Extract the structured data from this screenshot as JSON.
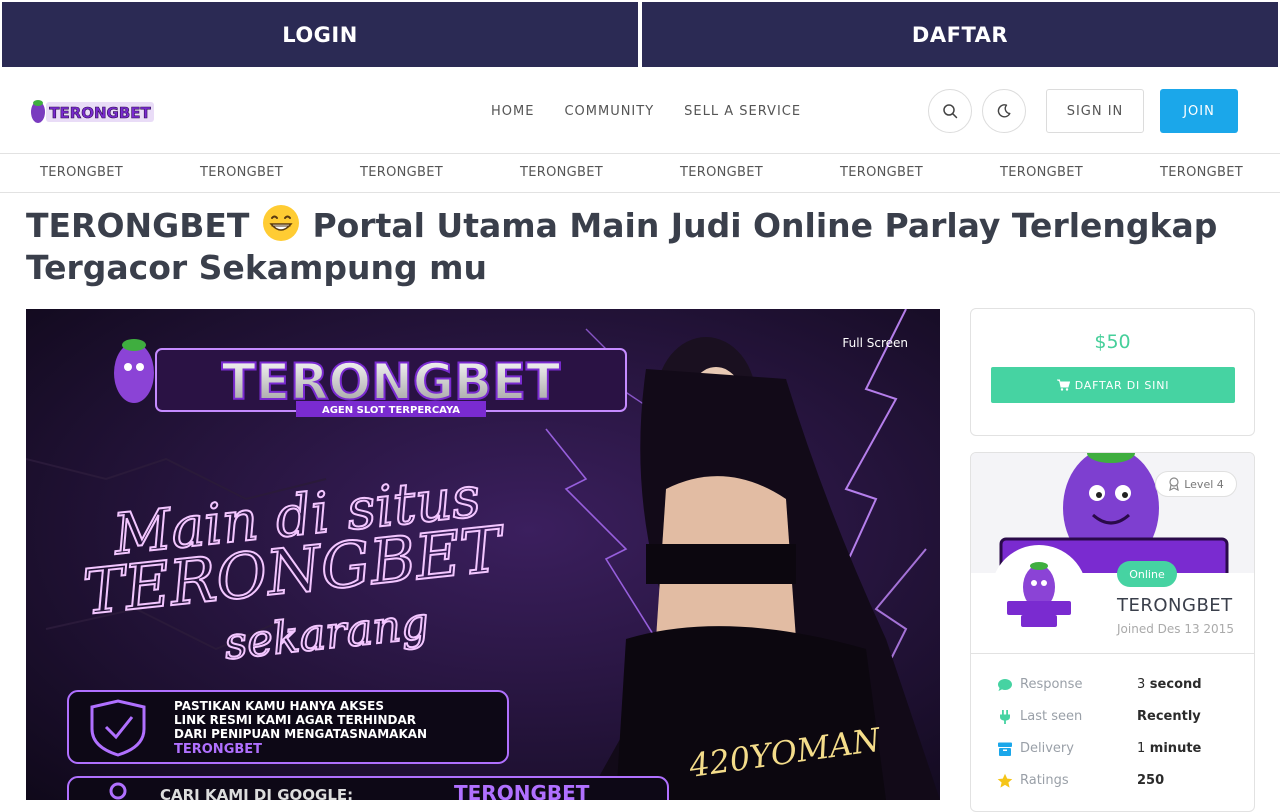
{
  "topbar": {
    "login_label": "LOGIN",
    "daftar_label": "DAFTAR"
  },
  "header": {
    "logo_text": "TERONGBET",
    "nav": [
      "HOME",
      "COMMUNITY",
      "SELL A SERVICE"
    ],
    "signin_label": "SIGN IN",
    "join_label": "JOIN"
  },
  "categories": [
    "TERONGBET",
    "TERONGBET",
    "TERONGBET",
    "TERONGBET",
    "TERONGBET",
    "TERONGBET",
    "TERONGBET",
    "TERONGBET"
  ],
  "page": {
    "title_part1": "TERONGBET",
    "title_part2": "Portal Utama Main Judi Online Parlay Terlengkap Tergacor Sekampung mu"
  },
  "hero": {
    "fullscreen_label": "Full Screen",
    "brand": "TERONGBET",
    "tagline": "AGEN SLOT TERPERCAYA",
    "script_line1": "Main di situs",
    "script_line2": "TERONGBET",
    "script_line3": "sekarang",
    "notice_line1": "PASTIKAN KAMU HANYA AKSES",
    "notice_line2": "LINK RESMI KAMI AGAR TERHINDAR",
    "notice_line3": "DARI PENIPUAN MENGATASNAMAKAN",
    "notice_line4": "TERONGBET",
    "google_label": "CARI KAMI DI GOOGLE:",
    "google_value": "TERONGBET",
    "signature": "420YOMAN"
  },
  "pricecard": {
    "price": "$50",
    "buy_label": "DAFTAR DI SINI"
  },
  "seller": {
    "level": "Level 4",
    "status": "Online",
    "name": "TERONGBET",
    "joined": "Joined Des 13 2015",
    "stats": [
      {
        "label": "Response",
        "num": "3",
        "unit": " second"
      },
      {
        "label": "Last seen",
        "num": "",
        "unit": "Recently"
      },
      {
        "label": "Delivery",
        "num": "1",
        "unit": " minute"
      },
      {
        "label": "Ratings",
        "num": "",
        "unit": "250"
      }
    ]
  },
  "colors": {
    "topbar": "#2b2a54",
    "join": "#1ba7ea",
    "accent": "#46d3a2",
    "title": "#3a3f4b"
  },
  "icons": [
    "search-icon",
    "moon-icon",
    "cart-icon",
    "level-badge-icon",
    "chat-icon",
    "plug-icon",
    "box-icon",
    "star-icon"
  ]
}
